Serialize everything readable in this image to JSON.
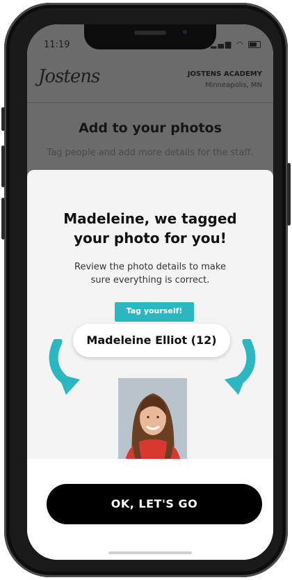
{
  "status_bar": {
    "time": "11:19"
  },
  "header": {
    "logo_text": "Jostens",
    "school_name": "JOSTENS ACADEMY",
    "school_location": "Minneapolis, MN"
  },
  "background_page": {
    "title": "Add to your photos",
    "subtitle": "Tag people and add more details for the staff."
  },
  "modal": {
    "title_line1": "Madeleine, we tagged",
    "title_line2": "your photo for you!",
    "desc_line1": "Review the photo details to make",
    "desc_line2": "sure everything is correct.",
    "tag_button_label": "Tag yourself!",
    "tagged_name": "Madeleine Elliot (12)",
    "cta_label": "OK, LET'S GO"
  },
  "colors": {
    "accent": "#2bb7bf",
    "cta": "#000000"
  }
}
